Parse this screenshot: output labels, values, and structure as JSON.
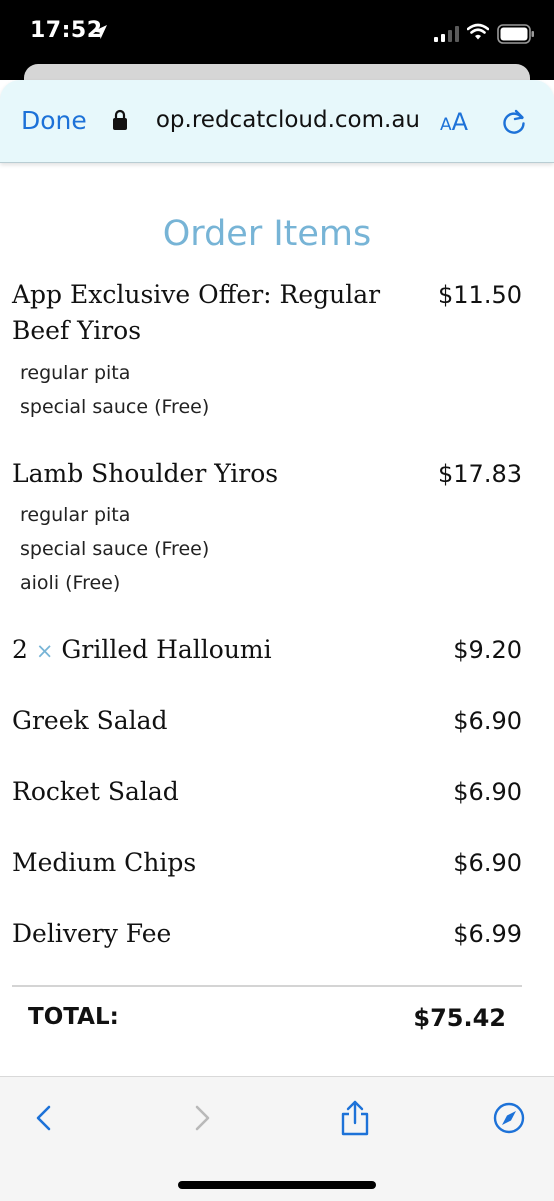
{
  "status_bar": {
    "time": "17:52"
  },
  "browser": {
    "done_label": "Done",
    "url": "op.redcatcloud.com.au",
    "text_size_small": "A",
    "text_size_large": "A"
  },
  "order": {
    "title": "Order Items",
    "items": [
      {
        "name": "App Exclusive Offer: Regular Beef Yiros",
        "price": "$11.50",
        "modifiers": [
          "regular pita",
          "special sauce (Free)"
        ]
      },
      {
        "name": "Lamb Shoulder Yiros",
        "price": "$17.83",
        "modifiers": [
          "regular pita",
          "special sauce (Free)",
          "aioli (Free)"
        ]
      },
      {
        "quantity": "2",
        "qty_symbol": "×",
        "name": "Grilled Halloumi",
        "price": "$9.20",
        "modifiers": []
      },
      {
        "name": "Greek Salad",
        "price": "$6.90",
        "modifiers": []
      },
      {
        "name": "Rocket Salad",
        "price": "$6.90",
        "modifiers": []
      },
      {
        "name": "Medium Chips",
        "price": "$6.90",
        "modifiers": []
      },
      {
        "name": "Delivery Fee",
        "price": "$6.99",
        "modifiers": []
      }
    ],
    "total_label": "TOTAL:",
    "total_value": "$75.42"
  },
  "icons": {
    "accent": "#1d72d8",
    "title_color": "#77b4d6"
  }
}
